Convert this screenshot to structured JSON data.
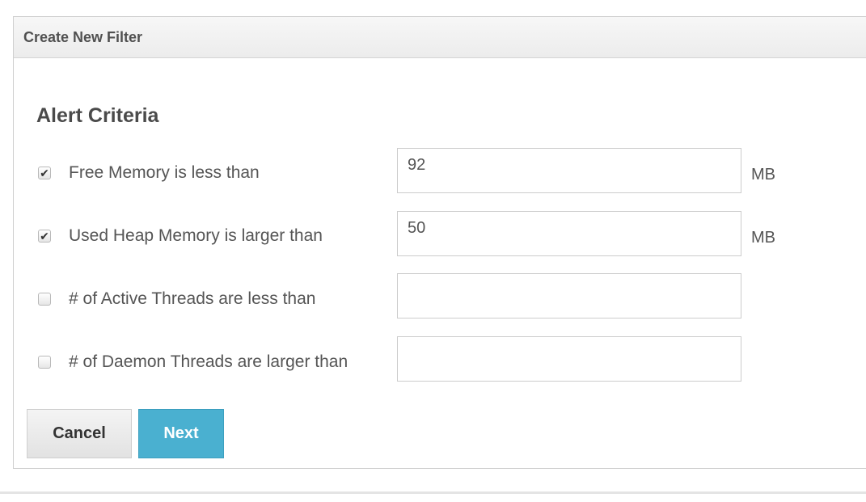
{
  "panel": {
    "title": "Create New Filter"
  },
  "section": {
    "title": "Alert Criteria"
  },
  "criteria": [
    {
      "label": "Free Memory is less than",
      "checked": true,
      "value": "92",
      "unit": "MB"
    },
    {
      "label": "Used Heap Memory is larger than",
      "checked": true,
      "value": "50",
      "unit": "MB"
    },
    {
      "label": "# of Active Threads are less than",
      "checked": false,
      "value": "",
      "unit": ""
    },
    {
      "label": "# of Daemon Threads are larger than",
      "checked": false,
      "value": "",
      "unit": ""
    }
  ],
  "buttons": {
    "cancel_label": "Cancel",
    "next_label": "Next"
  },
  "colors": {
    "primary": "#4ab0d0",
    "header_bg": "#f2f2f2",
    "border": "#cfcfcf"
  }
}
